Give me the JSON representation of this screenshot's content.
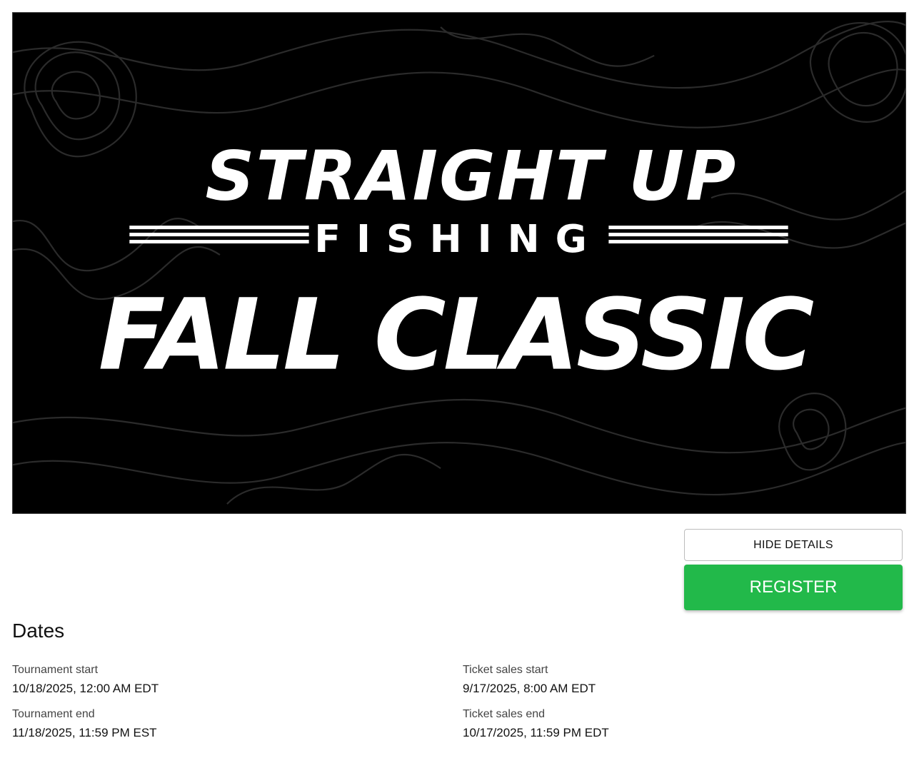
{
  "banner": {
    "line1": "STRAIGHT UP",
    "line2": "FISHING",
    "line3": "FALL CLASSIC",
    "background_color": "#000000",
    "text_color": "#ffffff"
  },
  "actions": {
    "hide_details_label": "HIDE DETAILS",
    "register_label": "REGISTER",
    "register_color": "#22b94a"
  },
  "dates": {
    "title": "Dates",
    "tournament_start": {
      "label": "Tournament start",
      "value": "10/18/2025, 12:00 AM EDT"
    },
    "tournament_end": {
      "label": "Tournament end",
      "value": "11/18/2025, 11:59 PM EST"
    },
    "ticket_sales_start": {
      "label": "Ticket sales start",
      "value": "9/17/2025, 8:00 AM EDT"
    },
    "ticket_sales_end": {
      "label": "Ticket sales end",
      "value": "10/17/2025, 11:59 PM EDT"
    }
  }
}
